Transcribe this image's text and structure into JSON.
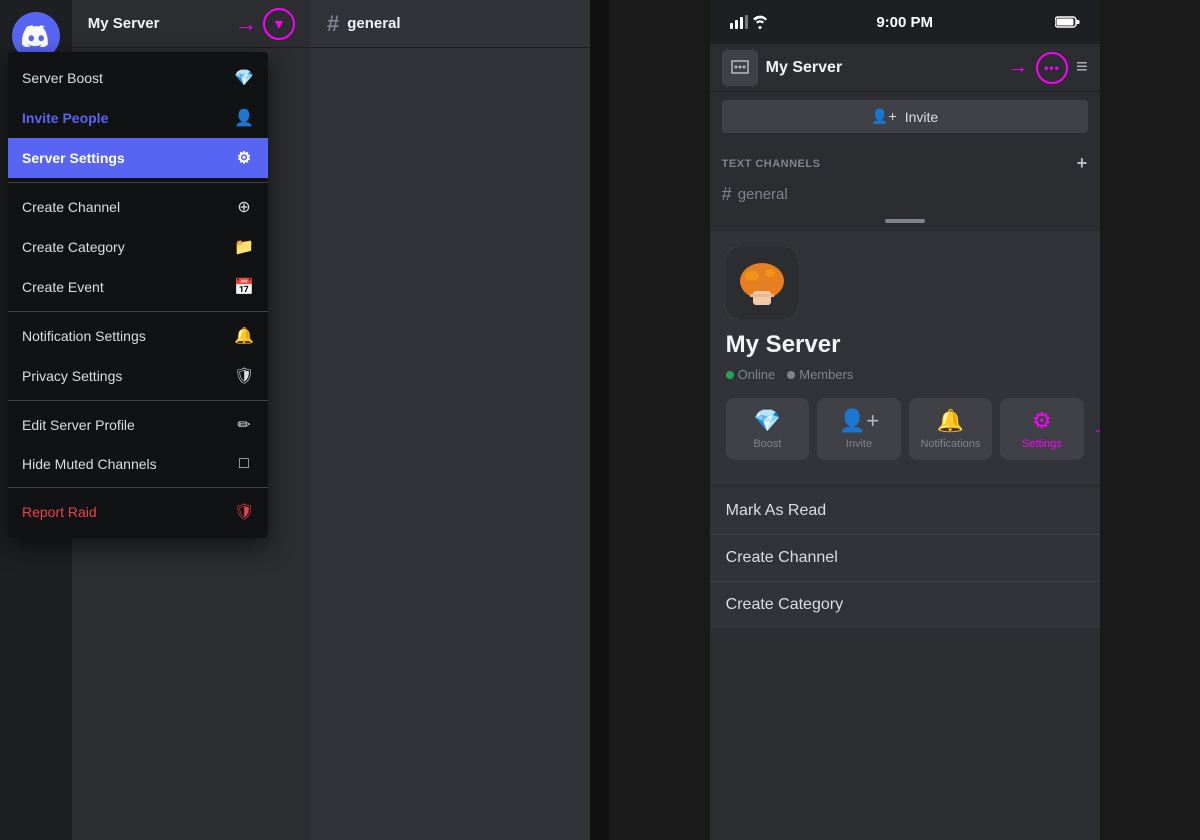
{
  "desktop": {
    "server_name": "My Server",
    "channel_name": "general",
    "dropdown_icon": "▾",
    "pink_arrow": "→",
    "context_menu": {
      "items": [
        {
          "id": "server-boost",
          "label": "Server Boost",
          "icon": "💎",
          "color": "normal"
        },
        {
          "id": "invite-people",
          "label": "Invite People",
          "icon": "👤+",
          "color": "invite"
        },
        {
          "id": "server-settings",
          "label": "Server Settings",
          "icon": "⚙",
          "color": "highlighted"
        },
        {
          "id": "create-channel",
          "label": "Create Channel",
          "icon": "➕",
          "color": "normal"
        },
        {
          "id": "create-category",
          "label": "Create Category",
          "icon": "📁",
          "color": "normal"
        },
        {
          "id": "create-event",
          "label": "Create Event",
          "icon": "📅",
          "color": "normal"
        },
        {
          "id": "notification-settings",
          "label": "Notification Settings",
          "icon": "🔔",
          "color": "normal"
        },
        {
          "id": "privacy-settings",
          "label": "Privacy Settings",
          "icon": "🛡",
          "color": "normal"
        },
        {
          "id": "edit-server-profile",
          "label": "Edit Server Profile",
          "icon": "✏",
          "color": "normal"
        },
        {
          "id": "hide-muted-channels",
          "label": "Hide Muted Channels",
          "icon": "□",
          "color": "normal"
        },
        {
          "id": "report-raid",
          "label": "Report Raid",
          "icon": "🛡",
          "color": "report"
        }
      ]
    }
  },
  "mobile": {
    "status_bar": {
      "time": "9:00 PM"
    },
    "server_name": "My Server",
    "more_icon": "•••",
    "invite_label": "Invite",
    "text_channels_header": "TEXT CHANNELS",
    "channel_general": "general",
    "server_title": "My Server",
    "stats": {
      "online_label": "Online",
      "members_label": "Members"
    },
    "actions": [
      {
        "id": "boost",
        "icon": "💎",
        "label": "Boost"
      },
      {
        "id": "invite",
        "icon": "👤",
        "label": "Invite"
      },
      {
        "id": "notifications",
        "icon": "🔔",
        "label": "Notifications"
      },
      {
        "id": "settings",
        "icon": "⚙",
        "label": "Settings"
      }
    ],
    "menu_items": [
      {
        "id": "mark-as-read",
        "label": "Mark As Read"
      },
      {
        "id": "create-channel",
        "label": "Create Channel"
      },
      {
        "id": "create-category",
        "label": "Create Category"
      }
    ]
  },
  "colors": {
    "pink": "#ff00ff",
    "discord_blue": "#5865f2",
    "red": "#ed4245"
  }
}
